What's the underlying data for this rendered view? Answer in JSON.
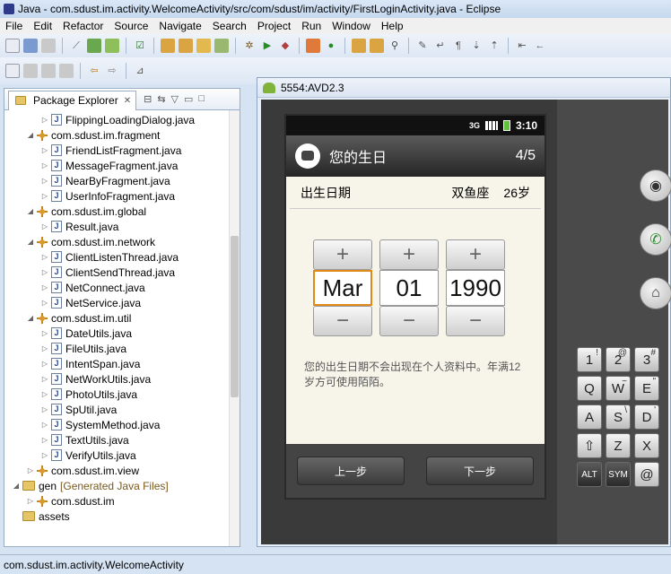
{
  "window": {
    "title": "Java - com.sdust.im.activity.WelcomeActivity/src/com/sdust/im/activity/FirstLoginActivity.java - Eclipse"
  },
  "menu": [
    "File",
    "Edit",
    "Refactor",
    "Source",
    "Navigate",
    "Search",
    "Project",
    "Run",
    "Window",
    "Help"
  ],
  "package_explorer": {
    "tab_label": "Package Explorer",
    "rows": [
      {
        "label": "FlippingLoadingDialog.java",
        "kind": "java",
        "indent": 3,
        "twisty": "▷"
      },
      {
        "label": "com.sdust.im.fragment",
        "kind": "pkg",
        "indent": 2,
        "twisty": "◢"
      },
      {
        "label": "FriendListFragment.java",
        "kind": "java",
        "indent": 3,
        "twisty": "▷"
      },
      {
        "label": "MessageFragment.java",
        "kind": "java",
        "indent": 3,
        "twisty": "▷"
      },
      {
        "label": "NearByFragment.java",
        "kind": "java",
        "indent": 3,
        "twisty": "▷"
      },
      {
        "label": "UserInfoFragment.java",
        "kind": "java",
        "indent": 3,
        "twisty": "▷"
      },
      {
        "label": "com.sdust.im.global",
        "kind": "pkg",
        "indent": 2,
        "twisty": "◢"
      },
      {
        "label": "Result.java",
        "kind": "java",
        "indent": 3,
        "twisty": "▷"
      },
      {
        "label": "com.sdust.im.network",
        "kind": "pkg",
        "indent": 2,
        "twisty": "◢"
      },
      {
        "label": "ClientListenThread.java",
        "kind": "java",
        "indent": 3,
        "twisty": "▷"
      },
      {
        "label": "ClientSendThread.java",
        "kind": "java",
        "indent": 3,
        "twisty": "▷"
      },
      {
        "label": "NetConnect.java",
        "kind": "java",
        "indent": 3,
        "twisty": "▷"
      },
      {
        "label": "NetService.java",
        "kind": "java",
        "indent": 3,
        "twisty": "▷"
      },
      {
        "label": "com.sdust.im.util",
        "kind": "pkg",
        "indent": 2,
        "twisty": "◢"
      },
      {
        "label": "DateUtils.java",
        "kind": "java",
        "indent": 3,
        "twisty": "▷"
      },
      {
        "label": "FileUtils.java",
        "kind": "java",
        "indent": 3,
        "twisty": "▷"
      },
      {
        "label": "IntentSpan.java",
        "kind": "java",
        "indent": 3,
        "twisty": "▷"
      },
      {
        "label": "NetWorkUtils.java",
        "kind": "java",
        "indent": 3,
        "twisty": "▷"
      },
      {
        "label": "PhotoUtils.java",
        "kind": "java",
        "indent": 3,
        "twisty": "▷"
      },
      {
        "label": "SpUtil.java",
        "kind": "java",
        "indent": 3,
        "twisty": "▷"
      },
      {
        "label": "SystemMethod.java",
        "kind": "java",
        "indent": 3,
        "twisty": "▷"
      },
      {
        "label": "TextUtils.java",
        "kind": "java",
        "indent": 3,
        "twisty": "▷"
      },
      {
        "label": "VerifyUtils.java",
        "kind": "java",
        "indent": 3,
        "twisty": "▷"
      },
      {
        "label": "com.sdust.im.view",
        "kind": "pkg",
        "indent": 2,
        "twisty": "▷"
      },
      {
        "label": "gen",
        "note": "[Generated Java Files]",
        "kind": "folder",
        "indent": 1,
        "twisty": "◢"
      },
      {
        "label": "com.sdust.im",
        "kind": "pkg",
        "indent": 2,
        "twisty": "▷"
      },
      {
        "label": "assets",
        "kind": "folder",
        "indent": 1,
        "twisty": ""
      }
    ]
  },
  "status_bar": {
    "text": "com.sdust.im.activity.WelcomeActivity"
  },
  "emulator": {
    "title": "5554:AVD2.3",
    "status_time": "3:10",
    "status_net": "3G",
    "dialog_title": "您的生日",
    "step": "4/5",
    "field_label": "出生日期",
    "zodiac": "双鱼座",
    "age": "26岁",
    "pickers": [
      {
        "name": "month",
        "value": "Mar",
        "focused": true
      },
      {
        "name": "day",
        "value": "01",
        "focused": false
      },
      {
        "name": "year",
        "value": "1990",
        "focused": false
      }
    ],
    "note": "您的出生日期不会出现在个人资料中。年满12岁方可使用陌陌。",
    "prev_label": "上一步",
    "next_label": "下一步",
    "plus_glyph": "+",
    "minus_glyph": "−"
  },
  "keyboard": [
    {
      "key": "1",
      "sub": "!"
    },
    {
      "key": "2",
      "sub": "@"
    },
    {
      "key": "3",
      "sub": "#"
    },
    {
      "key": "Q",
      "sub": ""
    },
    {
      "key": "W",
      "sub": "~"
    },
    {
      "key": "E",
      "sub": "\""
    },
    {
      "key": "A",
      "sub": ""
    },
    {
      "key": "S",
      "sub": "\\"
    },
    {
      "key": "D",
      "sub": "'"
    },
    {
      "key": "⇧",
      "sub": ""
    },
    {
      "key": "Z",
      "sub": ""
    },
    {
      "key": "X",
      "sub": ""
    },
    {
      "key": "ALT",
      "sub": ""
    },
    {
      "key": "SYM",
      "sub": ""
    },
    {
      "key": "@",
      "sub": ""
    }
  ]
}
